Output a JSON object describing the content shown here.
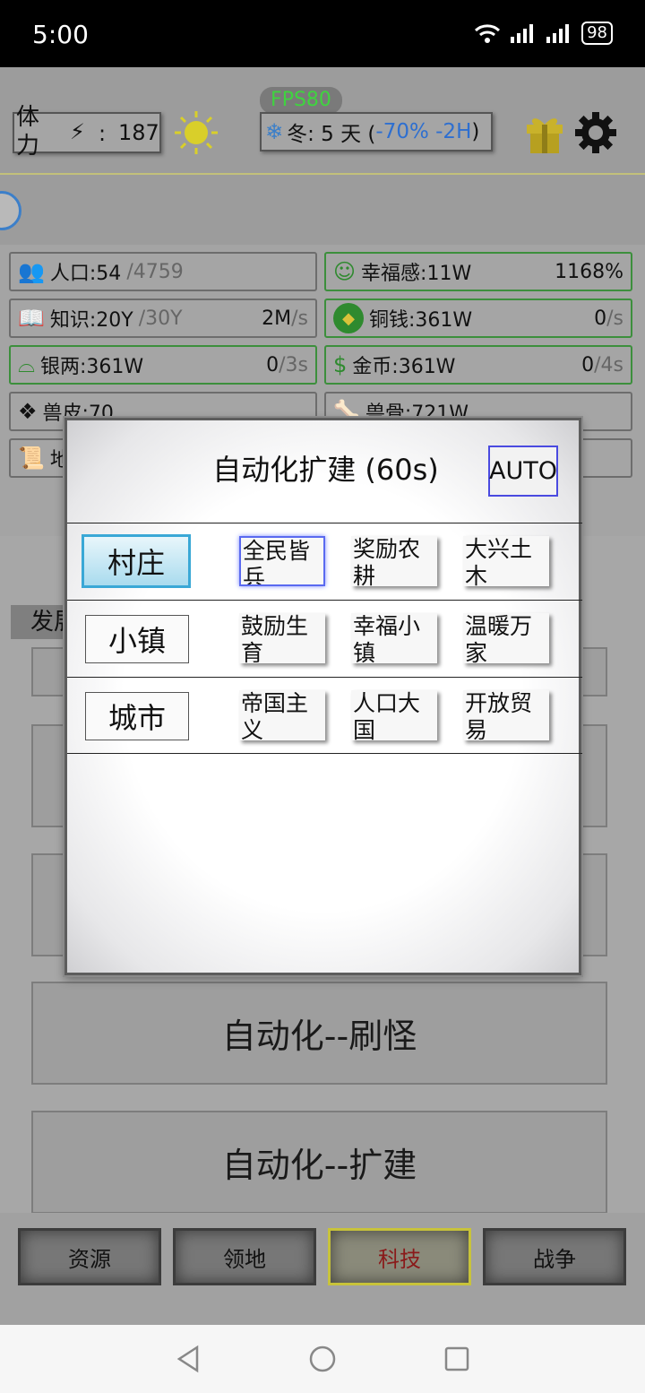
{
  "status_bar": {
    "time": "5:00",
    "battery": "98"
  },
  "top": {
    "stamina_label": "体力",
    "stamina_sep": ":",
    "stamina_value": "187",
    "fps": "FPS80",
    "season_text": "冬: 5 天 (",
    "season_modifier": "-70% -2H",
    "season_close": ")"
  },
  "resources": [
    {
      "label": "人口:54",
      "sub": "/4759",
      "rate": ""
    },
    {
      "label": "幸福感:11W",
      "sub": "",
      "rate": "1168%"
    },
    {
      "label": "知识:20Y",
      "sub": "/30Y",
      "rate": "2M",
      "rate_unit": "/s"
    },
    {
      "label": "铜钱:361W",
      "sub": "",
      "rate": "0",
      "rate_unit": "/s"
    },
    {
      "label": "银两:361W",
      "sub": "",
      "rate": "0",
      "rate_unit": "/3s"
    },
    {
      "label": "金币:361W",
      "sub": "",
      "rate": "0",
      "rate_unit": "/4s"
    },
    {
      "label": "兽皮:70",
      "sub": "",
      "rate": ""
    },
    {
      "label": "兽骨:721W",
      "sub": "",
      "rate": ""
    },
    {
      "label": "地",
      "sub": "",
      "rate": ""
    }
  ],
  "section_label": "发展",
  "automation_buttons": [
    "自动化--刷怪",
    "自动化--扩建"
  ],
  "bottom_nav": [
    "资源",
    "领地",
    "科技",
    "战争"
  ],
  "dialog": {
    "title": "自动化扩建 (60s)",
    "auto_label": "AUTO",
    "rows": [
      {
        "tier": "村庄",
        "options": [
          "全民皆兵",
          "奖励农耕",
          "大兴土木"
        ]
      },
      {
        "tier": "小镇",
        "options": [
          "鼓励生育",
          "幸福小镇",
          "温暖万家"
        ]
      },
      {
        "tier": "城市",
        "options": [
          "帝国主义",
          "人口大国",
          "开放贸易"
        ]
      }
    ]
  }
}
